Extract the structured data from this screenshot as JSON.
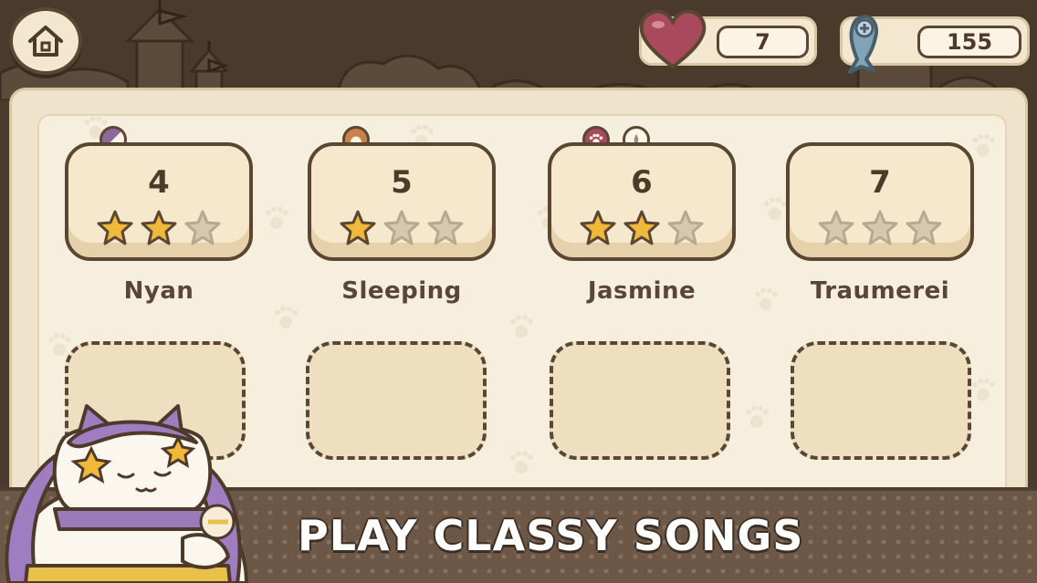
{
  "top_bar": {
    "lives": "7",
    "fish": "155"
  },
  "songs": [
    {
      "number": "4",
      "title": "Nyan",
      "stars_earned": 2,
      "stars_total": 3
    },
    {
      "number": "5",
      "title": "Sleeping",
      "stars_earned": 1,
      "stars_total": 3
    },
    {
      "number": "6",
      "title": "Jasmine",
      "stars_earned": 2,
      "stars_total": 3
    },
    {
      "number": "7",
      "title": "Traumerei",
      "stars_earned": 0,
      "stars_total": 3
    }
  ],
  "locked_slots": 4,
  "banner": {
    "text": "PLAY CLASSY SONGS"
  },
  "colors": {
    "star_filled": "#f0b93a",
    "star_empty": "#d5c7b0",
    "outline": "#5b4533",
    "heart": "#a84a5c",
    "fish": "#7fa3b7"
  }
}
